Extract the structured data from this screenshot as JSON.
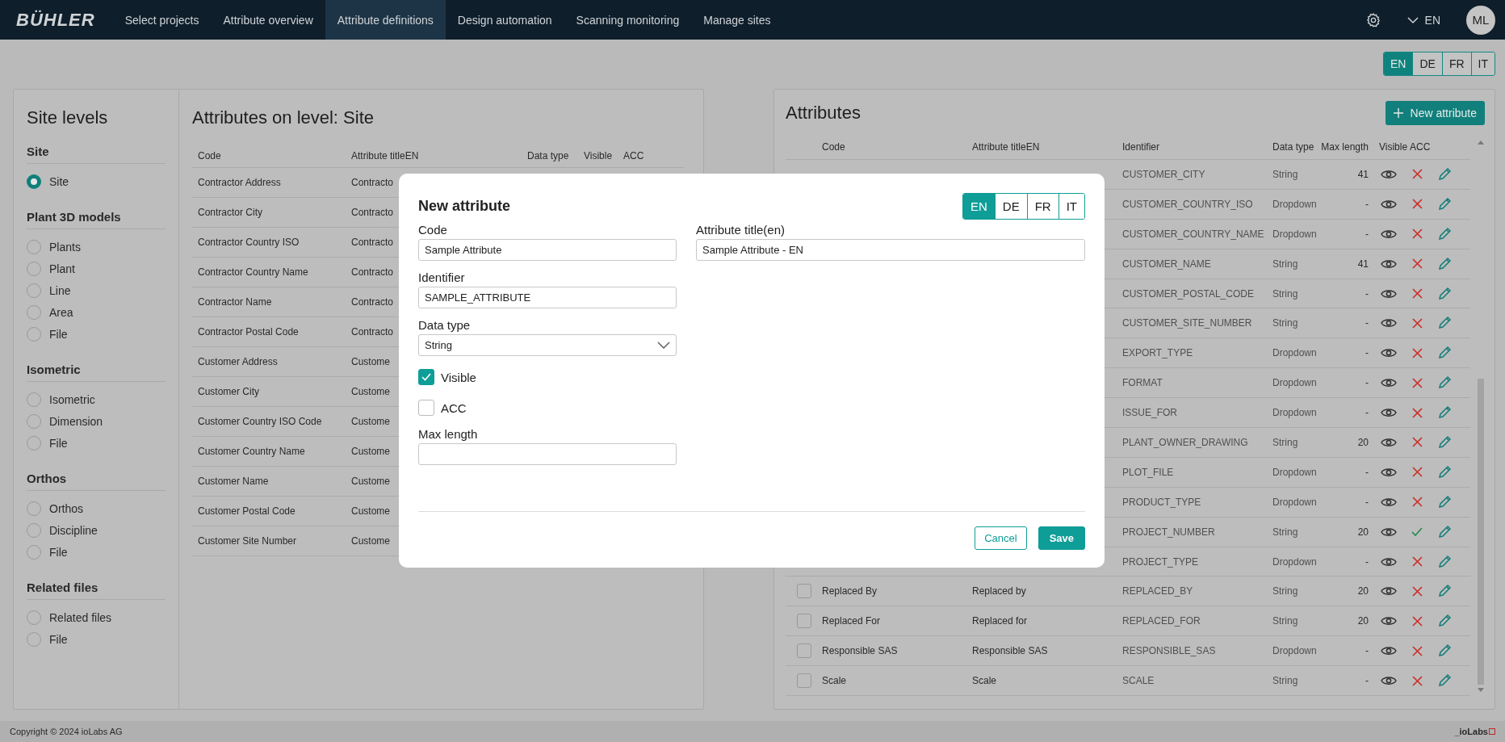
{
  "header": {
    "brand": "BÜHLER",
    "nav": [
      {
        "label": "Select projects",
        "selected": false
      },
      {
        "label": "Attribute overview",
        "selected": false
      },
      {
        "label": "Attribute definitions",
        "selected": true
      },
      {
        "label": "Design automation",
        "selected": false
      },
      {
        "label": "Scanning monitoring",
        "selected": false
      },
      {
        "label": "Manage sites",
        "selected": false
      }
    ],
    "language": "EN",
    "avatar": "ML"
  },
  "languages": [
    {
      "label": "EN",
      "selected": true
    },
    {
      "label": "DE",
      "selected": false
    },
    {
      "label": "FR",
      "selected": false
    },
    {
      "label": "IT",
      "selected": false
    }
  ],
  "site_levels": {
    "title": "Site levels",
    "groups": [
      {
        "title": "Site",
        "options": [
          {
            "label": "Site",
            "selected": true
          }
        ]
      },
      {
        "title": "Plant 3D models",
        "options": [
          {
            "label": "Plants",
            "selected": false
          },
          {
            "label": "Plant",
            "selected": false
          },
          {
            "label": "Line",
            "selected": false
          },
          {
            "label": "Area",
            "selected": false
          },
          {
            "label": "File",
            "selected": false
          }
        ]
      },
      {
        "title": "Isometric",
        "options": [
          {
            "label": "Isometric",
            "selected": false
          },
          {
            "label": "Dimension",
            "selected": false
          },
          {
            "label": "File",
            "selected": false
          }
        ]
      },
      {
        "title": "Orthos",
        "options": [
          {
            "label": "Orthos",
            "selected": false
          },
          {
            "label": "Discipline",
            "selected": false
          },
          {
            "label": "File",
            "selected": false
          }
        ]
      },
      {
        "title": "Related files",
        "options": [
          {
            "label": "Related files",
            "selected": false
          },
          {
            "label": "File",
            "selected": false
          }
        ]
      }
    ]
  },
  "level_table": {
    "title": "Attributes on level: Site",
    "columns": [
      "Code",
      "Attribute titleEN",
      "Data type",
      "Visible",
      "ACC"
    ],
    "rows": [
      {
        "code": "Contractor Address",
        "title": "Contracto"
      },
      {
        "code": "Contractor City",
        "title": "Contracto"
      },
      {
        "code": "Contractor Country ISO",
        "title": "Contracto"
      },
      {
        "code": "Contractor Country Name",
        "title": "Contracto"
      },
      {
        "code": "Contractor Name",
        "title": "Contracto"
      },
      {
        "code": "Contractor Postal Code",
        "title": "Contracto"
      },
      {
        "code": "Customer Address",
        "title": "Custome"
      },
      {
        "code": "Customer City",
        "title": "Custome"
      },
      {
        "code": "Customer Country ISO Code",
        "title": "Custome"
      },
      {
        "code": "Customer Country Name",
        "title": "Custome"
      },
      {
        "code": "Customer Name",
        "title": "Custome"
      },
      {
        "code": "Customer Postal Code",
        "title": "Custome"
      },
      {
        "code": "Customer Site Number",
        "title": "Custome"
      }
    ]
  },
  "attributes": {
    "title": "Attributes",
    "new_button": "New attribute",
    "columns": [
      "Code",
      "Attribute titleEN",
      "Identifier",
      "Data type",
      "Max length",
      "Visible",
      "ACC"
    ],
    "rows": [
      {
        "identifier": "CUSTOMER_CITY",
        "data_type": "String",
        "max_length": "41",
        "visible": true,
        "acc": false
      },
      {
        "identifier": "CUSTOMER_COUNTRY_ISO",
        "data_type": "Dropdown",
        "max_length": "-",
        "visible": true,
        "acc": false
      },
      {
        "identifier": "CUSTOMER_COUNTRY_NAME",
        "data_type": "Dropdown",
        "max_length": "-",
        "visible": true,
        "acc": false
      },
      {
        "identifier": "CUSTOMER_NAME",
        "data_type": "String",
        "max_length": "41",
        "visible": true,
        "acc": false
      },
      {
        "identifier": "CUSTOMER_POSTAL_CODE",
        "data_type": "String",
        "max_length": "-",
        "visible": true,
        "acc": false
      },
      {
        "identifier": "CUSTOMER_SITE_NUMBER",
        "data_type": "String",
        "max_length": "-",
        "visible": true,
        "acc": false
      },
      {
        "identifier": "EXPORT_TYPE",
        "data_type": "Dropdown",
        "max_length": "-",
        "visible": true,
        "acc": false
      },
      {
        "identifier": "FORMAT",
        "data_type": "Dropdown",
        "max_length": "-",
        "visible": true,
        "acc": false
      },
      {
        "identifier": "ISSUE_FOR",
        "data_type": "Dropdown",
        "max_length": "-",
        "visible": true,
        "acc": false
      },
      {
        "identifier": "PLANT_OWNER_DRAWING",
        "data_type": "String",
        "max_length": "20",
        "visible": true,
        "acc": false
      },
      {
        "identifier": "PLOT_FILE",
        "data_type": "Dropdown",
        "max_length": "-",
        "visible": true,
        "acc": false
      },
      {
        "identifier": "PRODUCT_TYPE",
        "data_type": "Dropdown",
        "max_length": "-",
        "visible": true,
        "acc": false
      },
      {
        "identifier": "PROJECT_NUMBER",
        "data_type": "String",
        "max_length": "20",
        "visible": true,
        "acc": true
      },
      {
        "identifier": "PROJECT_TYPE",
        "data_type": "Dropdown",
        "max_length": "-",
        "visible": true,
        "acc": false
      },
      {
        "code": "Replaced By",
        "title": "Replaced by",
        "checked": false,
        "identifier": "REPLACED_BY",
        "data_type": "String",
        "max_length": "20",
        "visible": true,
        "acc": false
      },
      {
        "code": "Replaced For",
        "title": "Replaced for",
        "checked": false,
        "identifier": "REPLACED_FOR",
        "data_type": "String",
        "max_length": "20",
        "visible": true,
        "acc": false
      },
      {
        "code": "Responsible SAS",
        "title": "Responsible SAS",
        "checked": false,
        "identifier": "RESPONSIBLE_SAS",
        "data_type": "Dropdown",
        "max_length": "-",
        "visible": true,
        "acc": false
      },
      {
        "code": "Scale",
        "title": "Scale",
        "checked": false,
        "identifier": "SCALE",
        "data_type": "String",
        "max_length": "-",
        "visible": true,
        "acc": false
      }
    ]
  },
  "dialog": {
    "title": "New attribute",
    "languages": [
      {
        "label": "EN",
        "selected": true
      },
      {
        "label": "DE",
        "selected": false
      },
      {
        "label": "FR",
        "selected": false
      },
      {
        "label": "IT",
        "selected": false
      }
    ],
    "fields": [
      {
        "kind": "text",
        "label": "Code",
        "value": "Sample Attribute"
      },
      {
        "kind": "text",
        "label": "Identifier",
        "value": "SAMPLE_ATTRIBUTE"
      },
      {
        "kind": "select",
        "label": "Data type",
        "value": "String"
      },
      {
        "kind": "checkbox",
        "label": "Visible",
        "checked": true
      },
      {
        "kind": "checkbox",
        "label": "ACC",
        "checked": false
      },
      {
        "kind": "text",
        "label": "Max length"
      }
    ],
    "title_field": {
      "label": "Attribute title(en)",
      "value": "Sample Attribute - EN"
    },
    "cancel": "Cancel",
    "save": "Save"
  },
  "footer": {
    "copyright": "Copyright © 2024 ioLabs AG",
    "brand": "_ioLabs"
  }
}
